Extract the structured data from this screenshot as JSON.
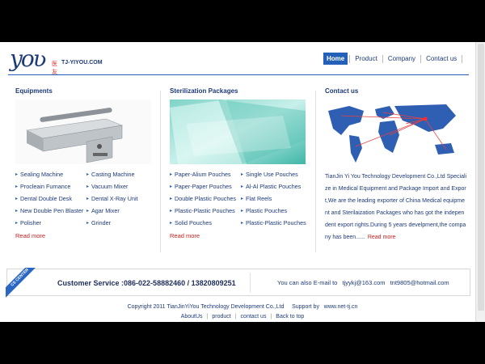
{
  "header": {
    "logo_mark": "yoʋ",
    "logo_cn": "医友",
    "logo_domain": "TJ-YIYOU.COM",
    "nav": [
      "Home",
      "Product",
      "Company",
      "Contact us"
    ]
  },
  "equipments": {
    "title": "Equipments",
    "items": [
      "Sealing Machine",
      "Casting Machine",
      "Procleain Furnance",
      "Vacuum Mixer",
      "Dental Double Desk",
      "Dental X-Ray Unit",
      "New Double Pen Blaster",
      "Agar Mixer",
      "Polisher",
      "Grinder"
    ],
    "read_more": "Read more"
  },
  "packages": {
    "title": "Sterilization Packages",
    "items": [
      "Paper-Alium Pouches",
      "Single Use Pouches",
      "Paper-Paper Pouches",
      "Al-Al Plastic Pouches",
      "Double Plastic Pouches",
      "Flat Reels",
      "Plastic-Plastic Pouches",
      "Plastic Pouches",
      "Solid Pouches",
      "Plastic-Plastic Pouches"
    ],
    "read_more": "Read more"
  },
  "contact": {
    "title": "Contact us",
    "text": "TianJin Yi You Technology Development Co.,Ltd Specialize in Medical Equipment and Package Import and Export,We are the leading exporter of China Medical equipment and Sterilaization Packages who has got the independent export rights.During 5 years develpment,the company has been......",
    "read_more": "Read more"
  },
  "service": {
    "ribbon": "CS CENTER",
    "label": "Customer Service :086-022-58882460 / 13820809251",
    "email_prefix": "You can also E-mail to",
    "email1": "tjyykj@163.com",
    "email2": "tnt9805@hotmail.com"
  },
  "footer": {
    "copyright": "Copyright 2011 TianJinYiYou Technology Development Co.,Ltd     Support by   www.net-tj.cn",
    "links": [
      "AboutUs",
      "product",
      "contact us",
      "Back to top"
    ]
  }
}
